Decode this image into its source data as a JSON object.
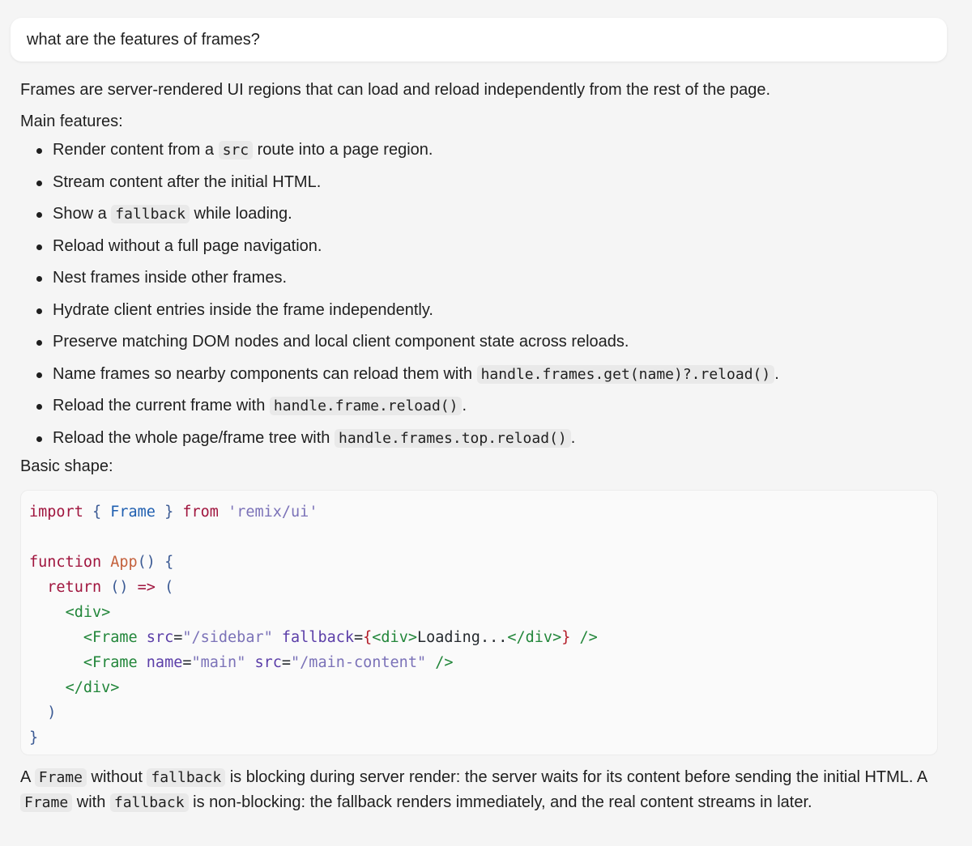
{
  "question": "what are the features of frames?",
  "answer": {
    "intro": "Frames are server-rendered UI regions that can load and reload independently from the rest of the page.",
    "features_heading": "Main features:",
    "features": [
      {
        "before": "Render content from a ",
        "code": "src",
        "after": " route into a page region."
      },
      {
        "before": "Stream content after the initial HTML.",
        "code": "",
        "after": ""
      },
      {
        "before": "Show a ",
        "code": "fallback",
        "after": " while loading."
      },
      {
        "before": "Reload without a full page navigation.",
        "code": "",
        "after": ""
      },
      {
        "before": "Nest frames inside other frames.",
        "code": "",
        "after": ""
      },
      {
        "before": "Hydrate client entries inside the frame independently.",
        "code": "",
        "after": ""
      },
      {
        "before": "Preserve matching DOM nodes and local client component state across reloads.",
        "code": "",
        "after": ""
      },
      {
        "before": "Name frames so nearby components can reload them with ",
        "code": "handle.frames.get(name)?.reload()",
        "after": "."
      },
      {
        "before": "Reload the current frame with ",
        "code": "handle.frame.reload()",
        "after": "."
      },
      {
        "before": "Reload the whole page/frame tree with ",
        "code": "handle.frames.top.reload()",
        "after": "."
      }
    ],
    "shape_heading": "Basic shape:",
    "code_lines": [
      [
        {
          "t": "import",
          "c": "kw2"
        },
        {
          "t": " { ",
          "c": "punc"
        },
        {
          "t": "Frame",
          "c": "id"
        },
        {
          "t": " } ",
          "c": "punc"
        },
        {
          "t": "from",
          "c": "kw2"
        },
        {
          "t": " ",
          "c": "plain"
        },
        {
          "t": "'remix/ui'",
          "c": "str"
        }
      ],
      [],
      [
        {
          "t": "function",
          "c": "kw2"
        },
        {
          "t": " ",
          "c": "plain"
        },
        {
          "t": "App",
          "c": "fn"
        },
        {
          "t": "() {",
          "c": "punc"
        }
      ],
      [
        {
          "t": "  ",
          "c": "plain"
        },
        {
          "t": "return",
          "c": "kw2"
        },
        {
          "t": " () ",
          "c": "punc"
        },
        {
          "t": "=>",
          "c": "kw2"
        },
        {
          "t": " (",
          "c": "punc"
        }
      ],
      [
        {
          "t": "    ",
          "c": "plain"
        },
        {
          "t": "<div>",
          "c": "tag"
        }
      ],
      [
        {
          "t": "      ",
          "c": "plain"
        },
        {
          "t": "<Frame",
          "c": "tag"
        },
        {
          "t": " ",
          "c": "plain"
        },
        {
          "t": "src",
          "c": "attr"
        },
        {
          "t": "=",
          "c": "plain"
        },
        {
          "t": "\"/sidebar\"",
          "c": "str"
        },
        {
          "t": " ",
          "c": "plain"
        },
        {
          "t": "fallback",
          "c": "attr"
        },
        {
          "t": "=",
          "c": "plain"
        },
        {
          "t": "{",
          "c": "kw"
        },
        {
          "t": "<div>",
          "c": "tag"
        },
        {
          "t": "Loading...",
          "c": "plain"
        },
        {
          "t": "</div>",
          "c": "tag"
        },
        {
          "t": "}",
          "c": "kw"
        },
        {
          "t": " />",
          "c": "tag"
        }
      ],
      [
        {
          "t": "      ",
          "c": "plain"
        },
        {
          "t": "<Frame",
          "c": "tag"
        },
        {
          "t": " ",
          "c": "plain"
        },
        {
          "t": "name",
          "c": "attr"
        },
        {
          "t": "=",
          "c": "plain"
        },
        {
          "t": "\"main\"",
          "c": "str"
        },
        {
          "t": " ",
          "c": "plain"
        },
        {
          "t": "src",
          "c": "attr"
        },
        {
          "t": "=",
          "c": "plain"
        },
        {
          "t": "\"/main-content\"",
          "c": "str"
        },
        {
          "t": " />",
          "c": "tag"
        }
      ],
      [
        {
          "t": "    ",
          "c": "plain"
        },
        {
          "t": "</div>",
          "c": "tag"
        }
      ],
      [
        {
          "t": "  ",
          "c": "plain"
        },
        {
          "t": ")",
          "c": "punc"
        }
      ],
      [
        {
          "t": "}",
          "c": "punc"
        }
      ]
    ],
    "closing": [
      {
        "t": "A ",
        "code": false
      },
      {
        "t": "Frame",
        "code": true
      },
      {
        "t": " without ",
        "code": false
      },
      {
        "t": "fallback",
        "code": true
      },
      {
        "t": " is blocking during server render: the server waits for its content before sending the initial HTML. A ",
        "code": false
      },
      {
        "t": "Frame",
        "code": true
      },
      {
        "t": " with ",
        "code": false
      },
      {
        "t": "fallback",
        "code": true
      },
      {
        "t": " is non-blocking: the fallback renders immediately, and the real content streams in later.",
        "code": false
      }
    ]
  }
}
